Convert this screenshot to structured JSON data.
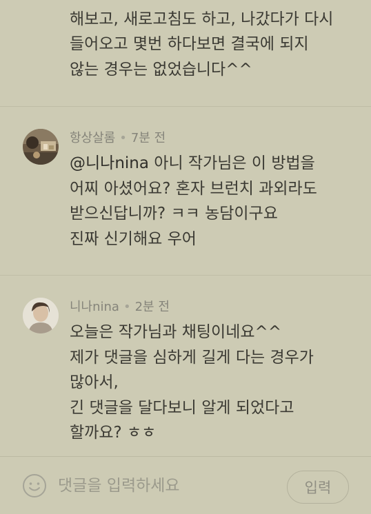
{
  "comments": [
    {
      "lines": [
        "해보고, 새로고침도 하고, 나갔다가 다시",
        "들어오고 몇번 하다보면 결국에 되지",
        "않는 경우는 없었습니다^^"
      ]
    },
    {
      "author": "항상살롬",
      "time": "7분 전",
      "mention": "@니나nina",
      "lines": [
        "아니 작가님은 이 방법을",
        "어찌 아셨어요? 혼자 브런치 과외라도",
        "받으신답니까? ㅋㅋ 농담이구요",
        "진짜 신기해요 우어"
      ]
    },
    {
      "author": "니나nina",
      "time": "2분 전",
      "lines": [
        "오늘은 작가님과 채팅이네요^^",
        "제가 댓글을 심하게 길게 다는 경우가",
        "많아서,",
        "긴 댓글을 달다보니 알게 되었다고",
        "할까요? ㅎㅎ"
      ]
    }
  ],
  "composer": {
    "placeholder": "댓글을 입력하세요",
    "submit_label": "입력",
    "emoji_icon": "smiley-icon"
  }
}
